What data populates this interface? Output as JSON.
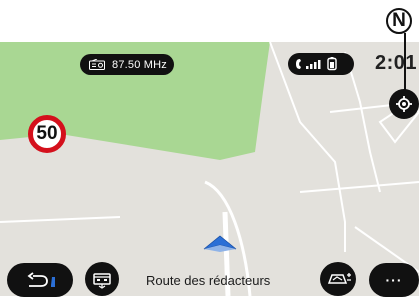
{
  "callout": {
    "label": "N"
  },
  "header": {
    "radio_frequency": "87.50 MHz",
    "clock": "2:01"
  },
  "speed_limit": {
    "value": "50"
  },
  "footer": {
    "road_name": "Route des rédacteurs",
    "more_label": "···"
  },
  "icons": {
    "radio": "radio-icon",
    "phone": "phone-icon",
    "signal": "signal-icon",
    "battery": "battery-icon",
    "recenter": "recenter-icon",
    "back": "back-icon",
    "traffic": "traffic-icon",
    "view": "map-view-icon",
    "vehicle": "vehicle-arrow-icon"
  },
  "colors": {
    "map_background": "#e3e1dc",
    "park_green": "#a9d793",
    "road": "#ffffff",
    "vehicle": "#2b6fd6",
    "speed_ring": "#d4101c"
  }
}
